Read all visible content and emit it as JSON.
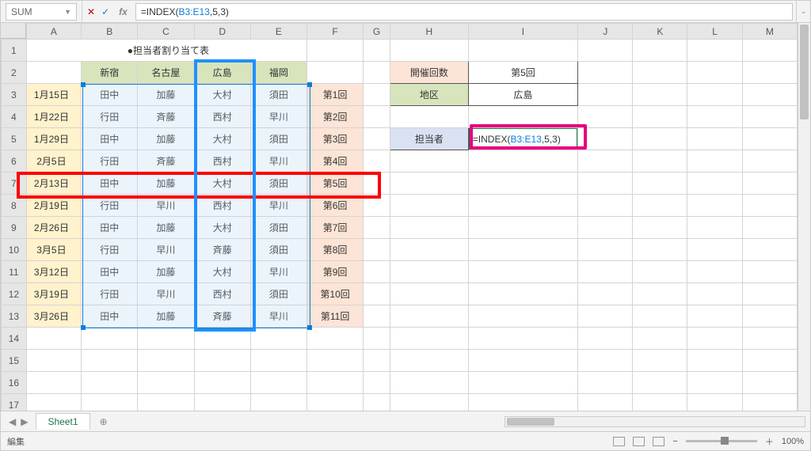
{
  "namebox": "SUM",
  "formula_prefix": "=INDEX(",
  "formula_ref": "B3:E13",
  "formula_suffix": ",5,3)",
  "title": "●担当者割り当て表",
  "cols": [
    "A",
    "B",
    "C",
    "D",
    "E",
    "F",
    "G",
    "H",
    "I",
    "J",
    "K",
    "L",
    "M"
  ],
  "rows": [
    "1",
    "2",
    "3",
    "4",
    "5",
    "6",
    "7",
    "8",
    "9",
    "10",
    "11",
    "12",
    "13",
    "14",
    "15",
    "16",
    "17"
  ],
  "headers": [
    "新宿",
    "名古屋",
    "広島",
    "福岡"
  ],
  "dates": [
    "1月15日",
    "1月22日",
    "1月29日",
    "2月5日",
    "2月13日",
    "2月19日",
    "2月26日",
    "3月5日",
    "3月12日",
    "3月19日",
    "3月26日"
  ],
  "body": [
    [
      "田中",
      "加藤",
      "大村",
      "須田",
      "第1回"
    ],
    [
      "行田",
      "斉藤",
      "西村",
      "早川",
      "第2回"
    ],
    [
      "田中",
      "加藤",
      "大村",
      "須田",
      "第3回"
    ],
    [
      "行田",
      "斉藤",
      "西村",
      "早川",
      "第4回"
    ],
    [
      "田中",
      "加藤",
      "大村",
      "須田",
      "第5回"
    ],
    [
      "行田",
      "早川",
      "西村",
      "早川",
      "第6回"
    ],
    [
      "田中",
      "加藤",
      "大村",
      "須田",
      "第7回"
    ],
    [
      "行田",
      "早川",
      "斉藤",
      "須田",
      "第8回"
    ],
    [
      "田中",
      "加藤",
      "大村",
      "早川",
      "第9回"
    ],
    [
      "行田",
      "早川",
      "西村",
      "須田",
      "第10回"
    ],
    [
      "田中",
      "加藤",
      "斉藤",
      "早川",
      "第11回"
    ]
  ],
  "side": {
    "r1l": "開催回数",
    "r1v": "第5回",
    "r2l": "地区",
    "r2v": "広島",
    "r3l": "担当者"
  },
  "cell_formula_prefix": "=INDEX(",
  "cell_formula_ref": "B3:E13",
  "cell_formula_suffix": ",5,3)",
  "sheet_tab": "Sheet1",
  "status": "編集",
  "zoom": "100%"
}
